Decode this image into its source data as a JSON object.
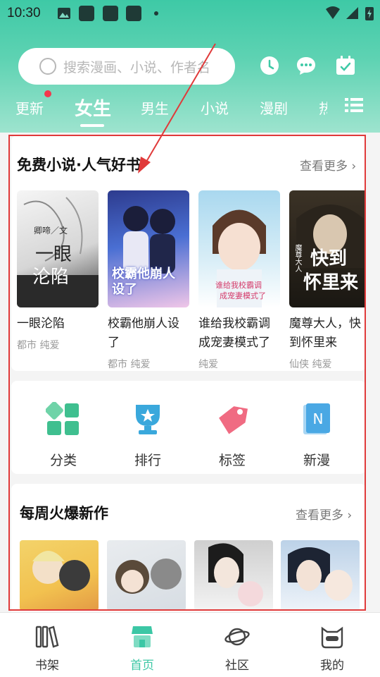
{
  "statusbar": {
    "time": "10:30"
  },
  "search": {
    "placeholder": "搜索漫画、小说、作者名"
  },
  "header_buttons": [
    "history-icon",
    "message-icon",
    "checkin-icon"
  ],
  "tabs": [
    {
      "label": "更新"
    },
    {
      "label": "女生"
    },
    {
      "label": "男生"
    },
    {
      "label": "小说"
    },
    {
      "label": "漫剧"
    },
    {
      "label": "热"
    }
  ],
  "free_novels": {
    "title": "免费小说·人气好书",
    "more": "查看更多",
    "books": [
      {
        "title": "一眼沦陷",
        "tags": "都市 纯爱"
      },
      {
        "title": "校霸他崩人设了",
        "tags": "都市 纯爱"
      },
      {
        "title": "谁给我校霸调成宠妻模式了",
        "tags": "纯爱"
      },
      {
        "title": "魔尊大人，快到怀里来",
        "tags": "仙侠 纯爱"
      }
    ]
  },
  "categories": [
    {
      "label": "分类",
      "icon": "category-grid-icon",
      "color": "#3fbf8f"
    },
    {
      "label": "排行",
      "icon": "ranking-trophy-icon",
      "color": "#3aa8dc"
    },
    {
      "label": "标签",
      "icon": "tag-icon",
      "color": "#f06b82"
    },
    {
      "label": "新漫",
      "icon": "new-comic-icon",
      "color": "#4aa8e4"
    }
  ],
  "weekly": {
    "title": "每周火爆新作",
    "more": "查看更多"
  },
  "bottom_nav": [
    {
      "label": "书架",
      "icon": "bookshelf-icon"
    },
    {
      "label": "首页",
      "icon": "home-icon"
    },
    {
      "label": "社区",
      "icon": "planet-icon"
    },
    {
      "label": "我的",
      "icon": "cat-face-icon"
    }
  ],
  "colors": {
    "accent": "#3cc7a5",
    "badge": "#f2384c",
    "highlight_frame": "#e03a3a"
  },
  "cover_texts": {
    "book1": [
      "卿啼／文",
      "一眼",
      "沦陷"
    ],
    "book2": "校霸他崩人设了",
    "book3": [
      "谁给我校霸调",
      "成宠妻模式了"
    ],
    "book4": [
      "魔尊大人",
      "快到",
      "怀里来"
    ]
  }
}
